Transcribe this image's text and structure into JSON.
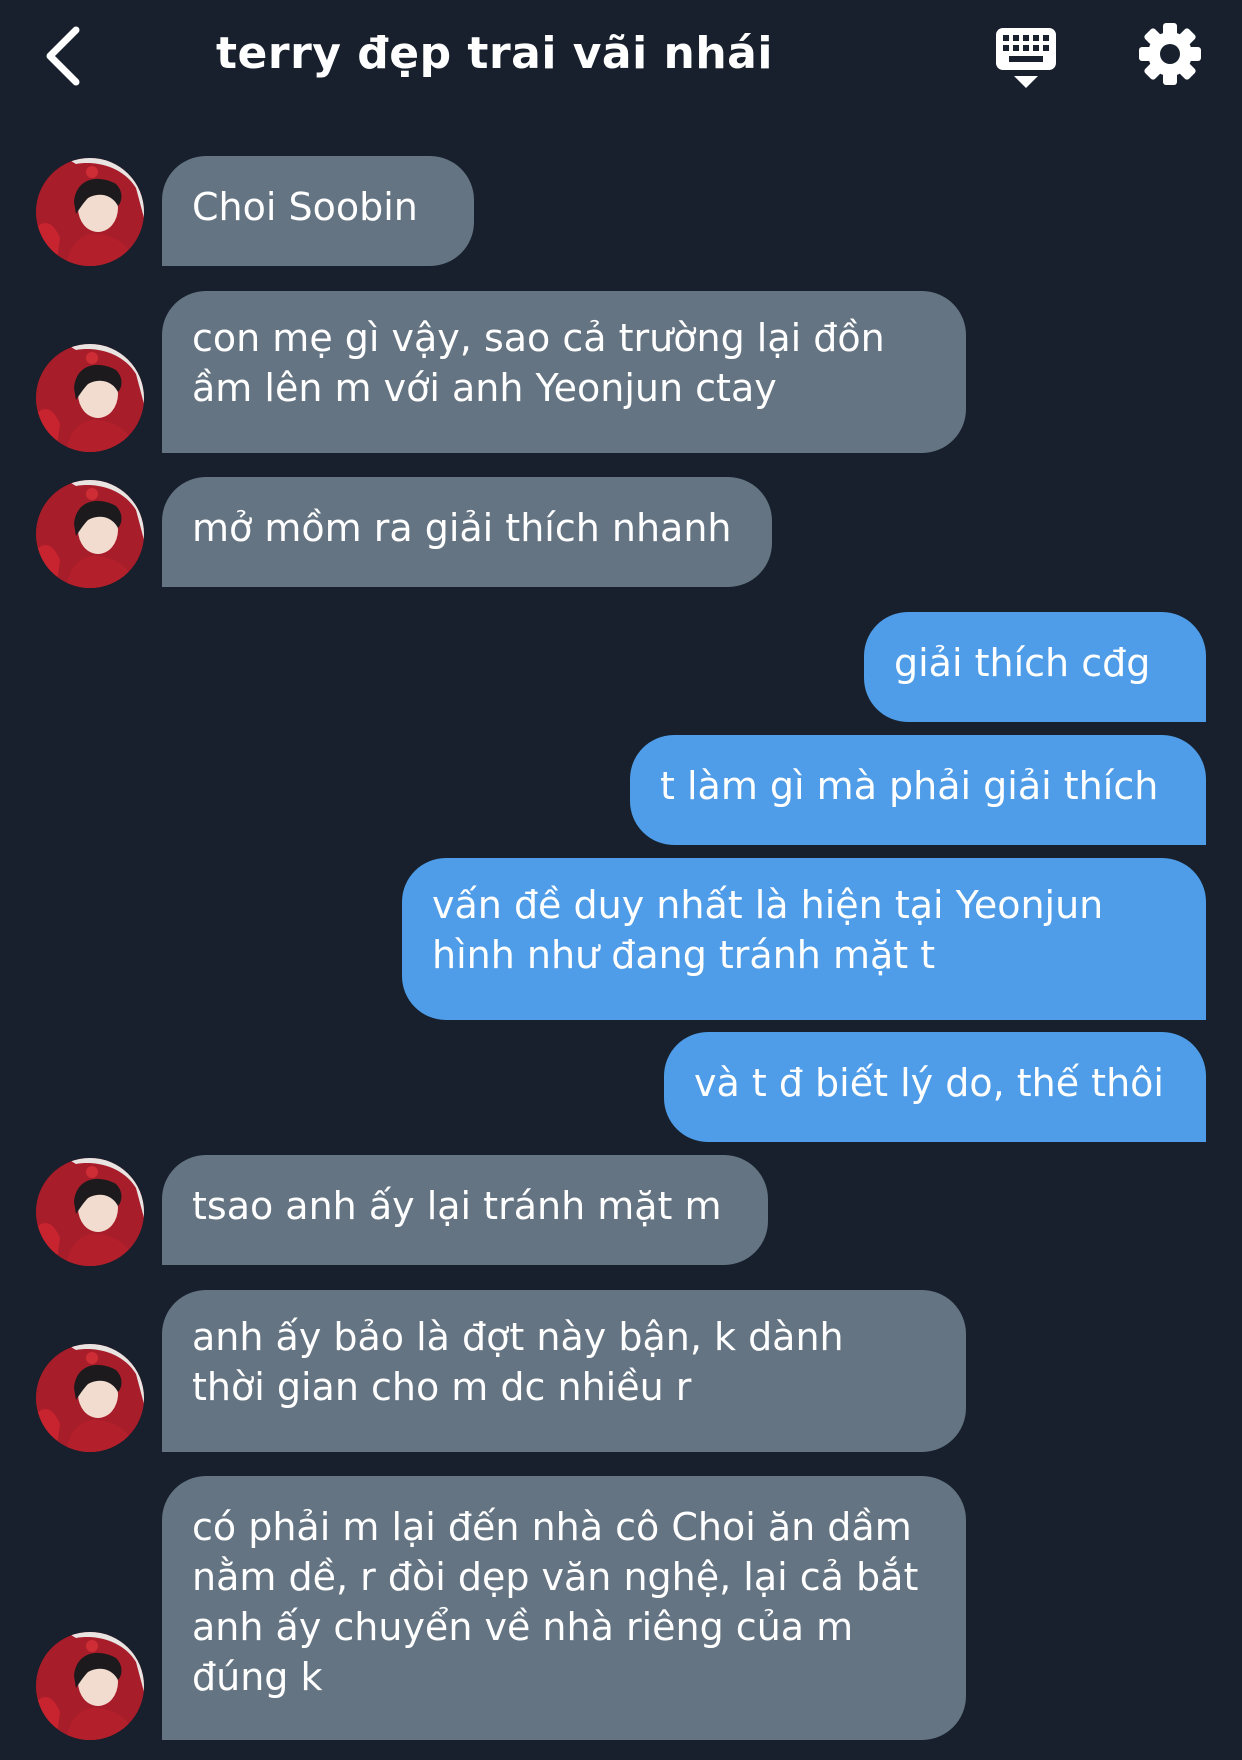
{
  "header": {
    "title": "terry đẹp trai vãi nhái",
    "back_icon": "chevron-left-icon",
    "keyboard_icon": "keyboard-icon",
    "settings_icon": "gear-icon"
  },
  "colors": {
    "background": "#17202c",
    "incoming_bubble": "#657482",
    "outgoing_bubble": "#4f9de8",
    "text": "#ffffff"
  },
  "messages": [
    {
      "side": "in",
      "text": "Choi Soobin"
    },
    {
      "side": "in",
      "text": "con mẹ gì vậy, sao cả trường lại đồn\nầm lên m với anh Yeonjun ctay"
    },
    {
      "side": "in",
      "text": "mở mồm ra giải thích nhanh"
    },
    {
      "side": "out",
      "text": "giải thích cđg"
    },
    {
      "side": "out",
      "text": "t làm gì mà phải giải thích"
    },
    {
      "side": "out",
      "text": "vấn đề duy nhất là hiện tại Yeonjun\nhình như đang tránh mặt t"
    },
    {
      "side": "out",
      "text": "và t đ biết lý do, thế thôi"
    },
    {
      "side": "in",
      "text": "tsao anh ấy lại tránh mặt m"
    },
    {
      "side": "in",
      "text": "anh ấy bảo là đợt này bận, k dành\nthời gian cho m dc nhiều r"
    },
    {
      "side": "in",
      "text": "có phải m lại đến nhà cô Choi ăn dầm\nnằm dề, r đòi dẹp văn nghệ, lại cả bắt\nanh ấy chuyển về nhà riêng của m\nđúng k"
    }
  ]
}
